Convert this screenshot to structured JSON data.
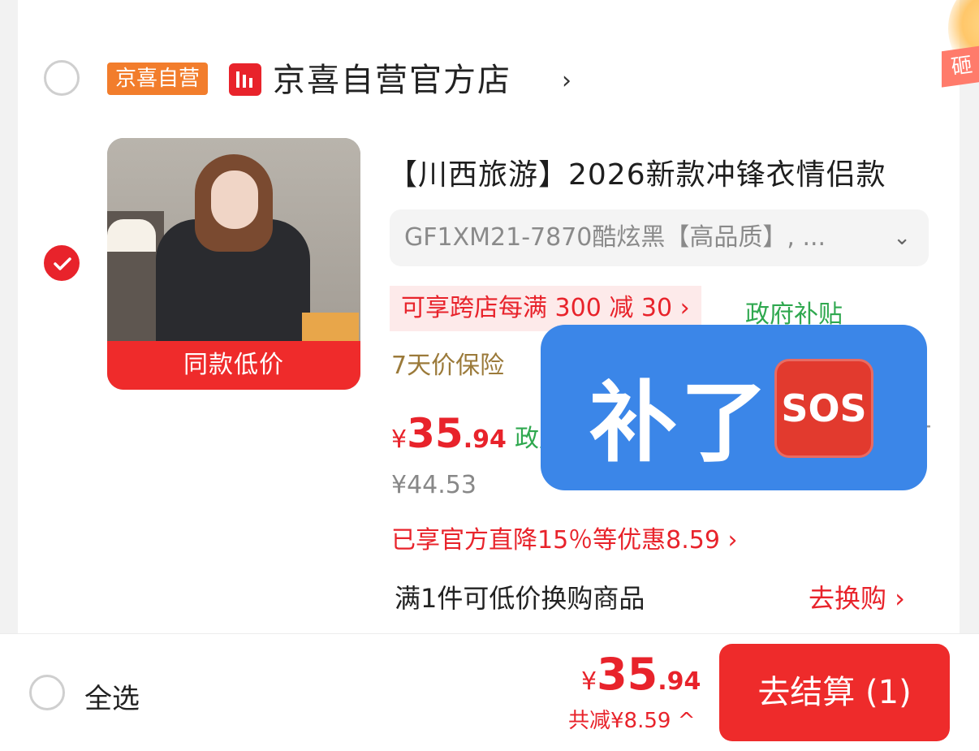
{
  "store": {
    "tag": "京喜自营",
    "name": "京喜自营官方店",
    "chevron": "›",
    "corner_badge": "砸"
  },
  "product": {
    "image_badge": "同款低价",
    "title": "【川西旅游】2026新款冲锋衣情侣款",
    "spec": "GF1XM21-7870酷炫黑【高品质】, ...",
    "spec_chevron": "⌄",
    "promo": "可享跨店每满 300 减 30 ›",
    "gov_tag": "政府补贴",
    "guarantee": "7天价保险",
    "price_yen": "¥",
    "price_int": "35",
    "price_dec": ".94",
    "price_gov": "政府补贴价",
    "original_price": "¥44.53",
    "discount_line": "已享官方直降15％等优惠8.59 ›",
    "swap_text": "满1件可低价换购商品",
    "swap_link": "去换购 ›",
    "plus": "+"
  },
  "overlay": {
    "text": "补了",
    "emoji": "SOS"
  },
  "footer": {
    "select_all": "全选",
    "total_yen": "¥",
    "total_int": "35",
    "total_dec": ".94",
    "saved": "共减¥8.59 ^",
    "checkout": "去结算 (1)"
  },
  "colors": {
    "accent_red": "#e8232b",
    "gov_green": "#2fa84f",
    "jx_orange": "#f27d2c",
    "overlay_blue": "#3b86e8"
  }
}
